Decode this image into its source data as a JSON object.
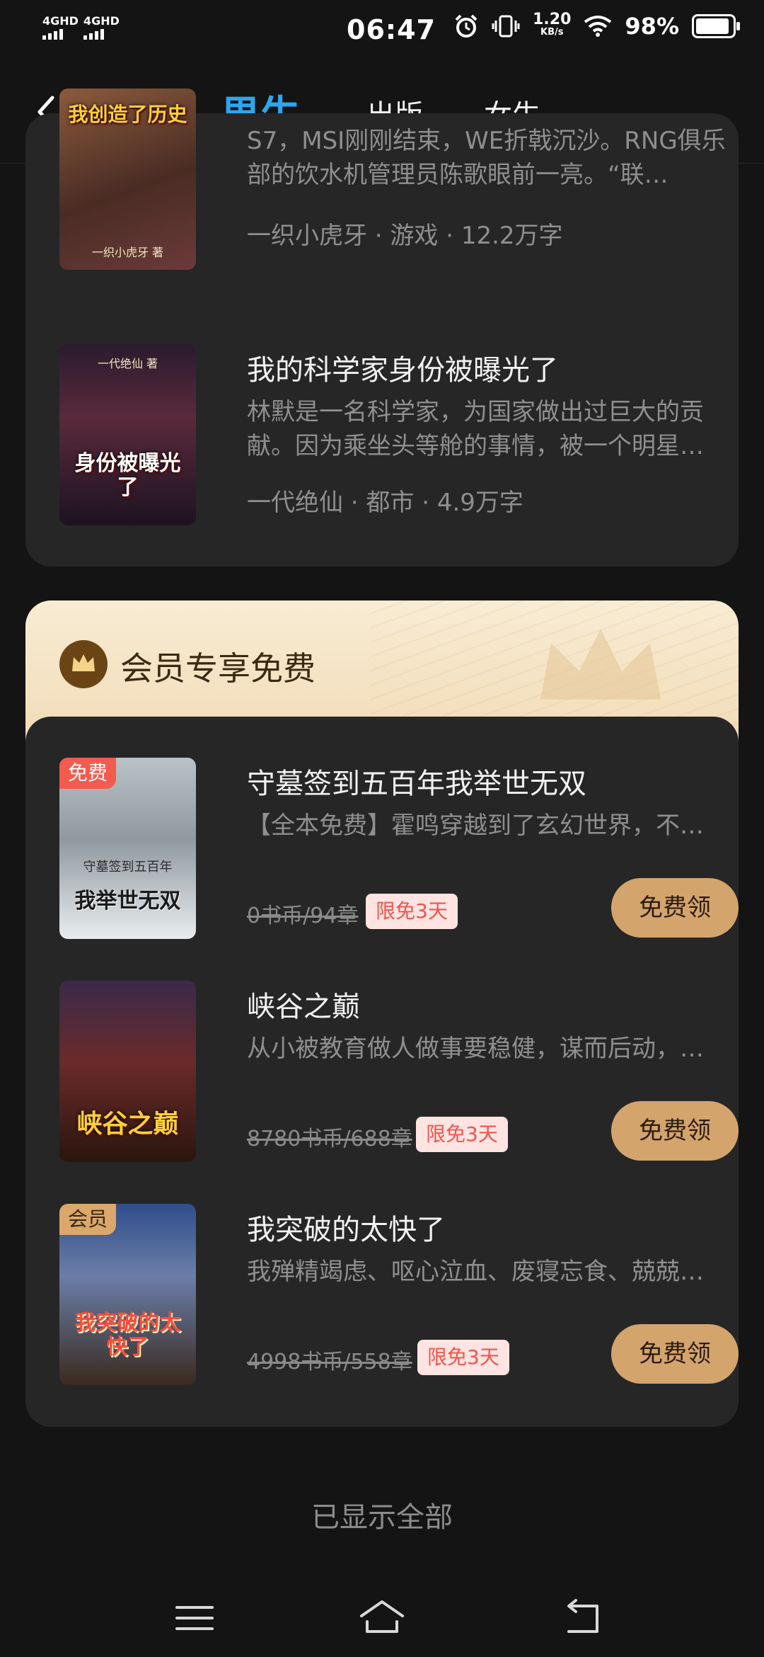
{
  "status_bar": {
    "signal1": "4GHD",
    "signal2": "4GHD",
    "time": "06:47",
    "net_speed_value": "1.20",
    "net_speed_unit": "KB/s",
    "battery": "98%"
  },
  "nav": {
    "tabs": [
      {
        "label": "男生",
        "active": true
      },
      {
        "label": "出版",
        "active": false
      },
      {
        "label": "女生",
        "active": false
      }
    ]
  },
  "top_list": [
    {
      "cover_title": "我创造了历史",
      "cover_sub": "一织小虎牙 著",
      "desc": "S7，MSI刚刚结束，WE折戟沉沙。RNG俱乐部的饮水机管理员陈歌眼前一亮。“联…",
      "meta": "一织小虎牙 · 游戏 · 12.2万字"
    },
    {
      "title": "我的科学家身份被曝光了",
      "cover_title": "身份被曝光了",
      "cover_sub": "一代绝仙 著",
      "desc": "林默是一名科学家，为国家做出过巨大的贡献。因为乘坐头等舱的事情，被一个明星…",
      "meta": "一代绝仙 · 都市 · 4.9万字"
    }
  ],
  "vip_section": {
    "title": "会员专享免费",
    "books": [
      {
        "badge": "免费",
        "title": "守墓签到五百年我举世无双",
        "cover_title": "我举世无双",
        "cover_sub": "守墓签到五百年",
        "desc": "【全本免费】霍鸣穿越到了玄幻世界，不…",
        "price": "0书币/94章",
        "limit": "限免3天",
        "button": "免费领"
      },
      {
        "badge": "",
        "title": "峡谷之巅",
        "cover_title": "峡谷之巅",
        "cover_sub": "",
        "desc": "从小被教育做人做事要稳健，谋而后动，…",
        "price": "8780书币/688章",
        "limit": "限免3天",
        "button": "免费领"
      },
      {
        "badge": "会员",
        "title": "我突破的太快了",
        "cover_title": "我突破的太快了",
        "cover_sub": "",
        "desc": "我殚精竭虑、呕心泣血、废寝忘食、兢兢…",
        "price": "4998书币/558章",
        "limit": "限免3天",
        "button": "免费领"
      }
    ]
  },
  "footer_note": "已显示全部",
  "colors": {
    "accent": "#2ea6ef",
    "gold_button": "#d4a46d",
    "limit_text": "#f2544b",
    "free_badge": "#f25b4e",
    "vip_badge": "#d9a86a"
  }
}
